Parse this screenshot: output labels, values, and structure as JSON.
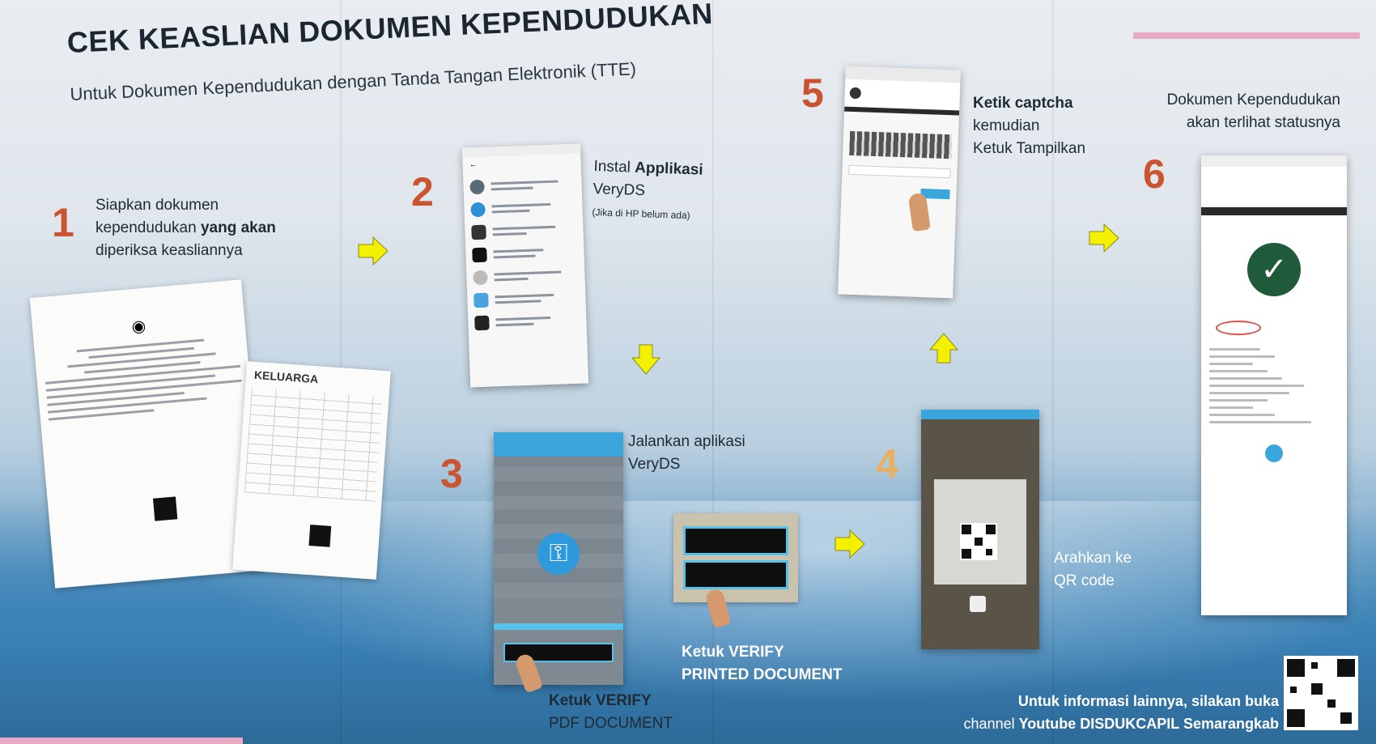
{
  "title": "CEK KEASLIAN DOKUMEN KEPENDUDUKAN",
  "subtitle": "Untuk Dokumen Kependudukan dengan Tanda Tangan Elektronik (TTE)",
  "steps": {
    "s1": {
      "number": "1",
      "line1": "Siapkan dokumen",
      "line2_a": "kependudukan ",
      "line2_b": "yang akan",
      "line3": "diperiksa keasliannya"
    },
    "s2": {
      "number": "2",
      "line1_a": "Instal ",
      "line1_b": "Applikasi",
      "line2": "VeryDS",
      "line3": "(Jika di HP belum ada)"
    },
    "s3": {
      "number": "3",
      "line1": "Jalankan aplikasi",
      "line2": "VeryDS",
      "tap_pdf_1": "Ketuk VERIFY",
      "tap_pdf_2": "PDF DOCUMENT",
      "tap_printed_1": "Ketuk VERIFY",
      "tap_printed_2": "PRINTED DOCUMENT"
    },
    "s4": {
      "number": "4",
      "line1": "Arahkan ke",
      "line2": "QR code"
    },
    "s5": {
      "number": "5",
      "line1": "Ketik captcha",
      "line2": "kemudian",
      "line3": "Ketuk Tampilkan"
    },
    "s6": {
      "number": "6",
      "line1": "Dokumen Kependudukan",
      "line2": "akan terlihat statusnya"
    }
  },
  "document_labels": {
    "kk": "KELUARGA"
  },
  "footer": {
    "line1": "Untuk informasi lainnya, silakan buka",
    "line2_a": "channel ",
    "line2_b": "Youtube DISDUKCAPIL Semarangkab"
  },
  "colors": {
    "step_number": "#c9542f",
    "arrow": "#f4f100",
    "app_header": "#3aa6dc"
  },
  "icons": [
    "arrow-right-icon",
    "arrow-down-icon",
    "arrow-up-icon",
    "verify-key-icon",
    "check-icon",
    "qr-code-icon",
    "tapping-hand-icon"
  ]
}
